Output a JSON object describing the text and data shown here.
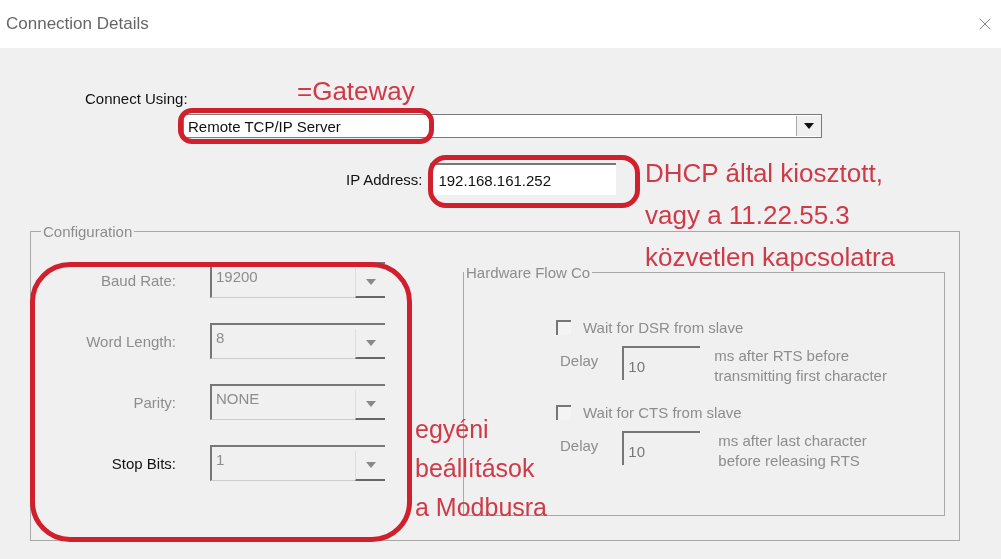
{
  "window": {
    "title": "Connection Details"
  },
  "connect_using": {
    "label": "Connect Using:",
    "value": "Remote TCP/IP Server"
  },
  "ip_address": {
    "label": "IP Address:",
    "value": "192.168.161.252"
  },
  "configuration": {
    "title": "Configuration",
    "fields": [
      {
        "label": "Baud Rate:",
        "value": "19200",
        "disabled": true
      },
      {
        "label": "Word Length:",
        "value": "8",
        "disabled": true
      },
      {
        "label": "Parity:",
        "value": "NONE",
        "disabled": true
      },
      {
        "label": "Stop Bits:",
        "value": "1",
        "disabled": false
      }
    ],
    "hardware_flow_control": {
      "title": "Hardware Flow Co",
      "options": [
        {
          "label": "Wait for DSR from slave",
          "checked": false,
          "delay_label": "Delay",
          "delay": "10",
          "note": "ms after RTS before\ntransmitting first character"
        },
        {
          "label": "Wait for CTS from slave",
          "checked": false,
          "delay_label": "Delay",
          "delay": "10",
          "note": "ms after last character\nbefore releasing RTS"
        }
      ]
    }
  },
  "annotations": [
    {
      "text": "=Gateway"
    },
    {
      "text": "DHCP által kiosztott,\nvagy a 11.22.55.3\nközvetlen kapcsolatra"
    },
    {
      "text": "egyéni\nbeállítások\na Modbusra"
    }
  ]
}
